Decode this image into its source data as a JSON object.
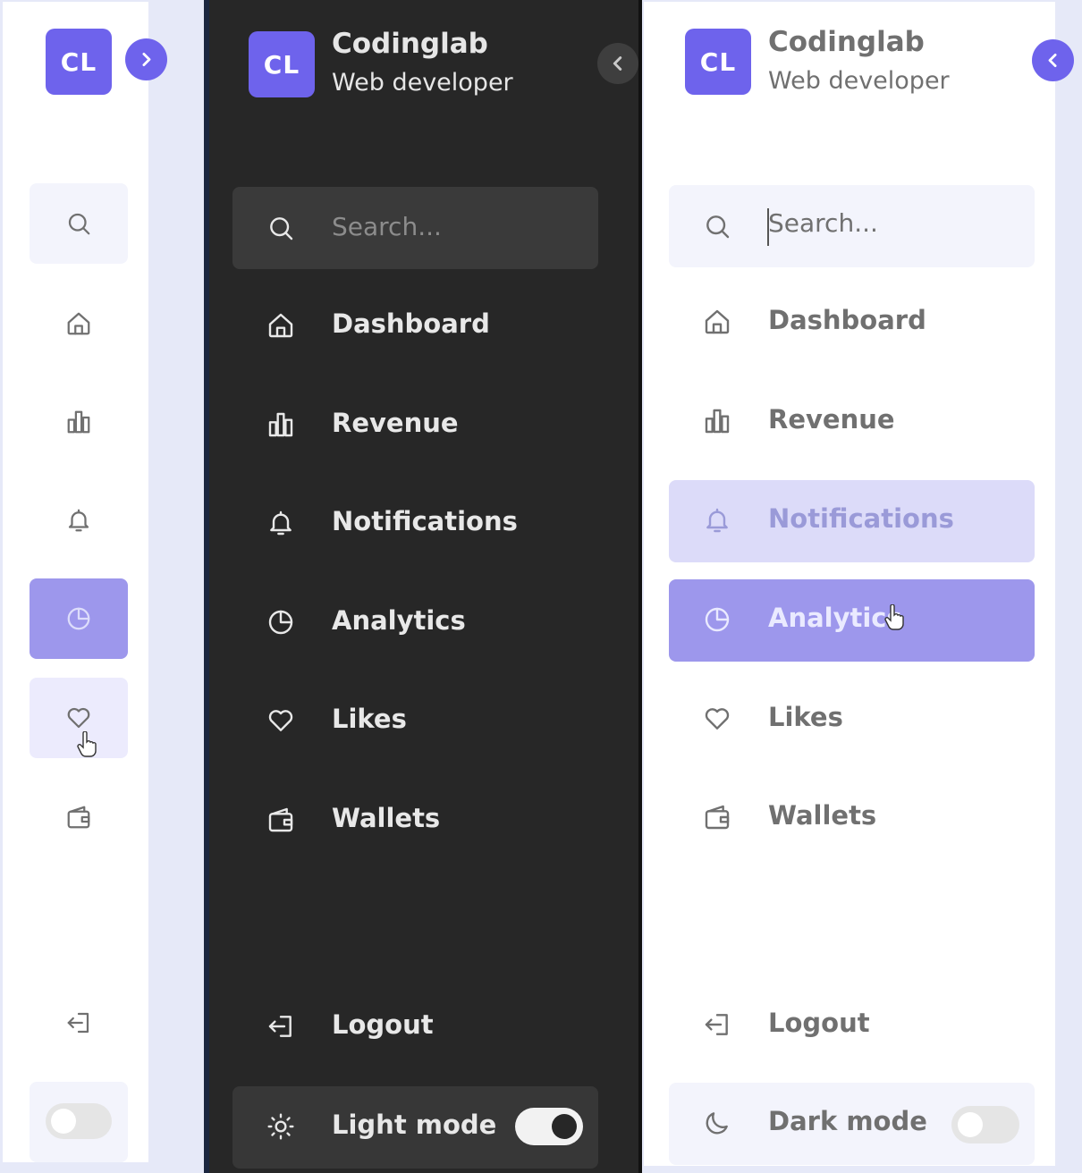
{
  "brand": {
    "initials": "CL",
    "name": "Codinglab",
    "role": "Web developer"
  },
  "search": {
    "placeholder": "Search..."
  },
  "menu": [
    {
      "label": "Dashboard",
      "icon": "home-icon"
    },
    {
      "label": "Revenue",
      "icon": "bar-chart-icon"
    },
    {
      "label": "Notifications",
      "icon": "bell-icon"
    },
    {
      "label": "Analytics",
      "icon": "pie-chart-icon"
    },
    {
      "label": "Likes",
      "icon": "heart-icon"
    },
    {
      "label": "Wallets",
      "icon": "wallet-icon"
    }
  ],
  "bottom": {
    "logout": "Logout",
    "dark_panel_mode_label": "Light mode",
    "light_panel_mode_label": "Dark mode"
  },
  "state": {
    "collapsed_panel": {
      "active_item": "Analytics",
      "hovered_item": "Likes",
      "dark_mode_toggle": "off"
    },
    "dark_panel": {
      "light_mode_toggle": "on"
    },
    "light_panel": {
      "active_item": "Analytics",
      "hovered_item": "Notifications",
      "dark_mode_toggle": "off"
    }
  },
  "colors": {
    "accent": "#6e63ec",
    "active_item": "#9d97ec",
    "hover_item": "#dcdbf9",
    "dark_bg": "#272727",
    "light_bg": "#ffffff",
    "page_bg": "#e6e9f8",
    "text_light_mode": "#707070",
    "text_dark_mode": "#e8e8e8"
  }
}
